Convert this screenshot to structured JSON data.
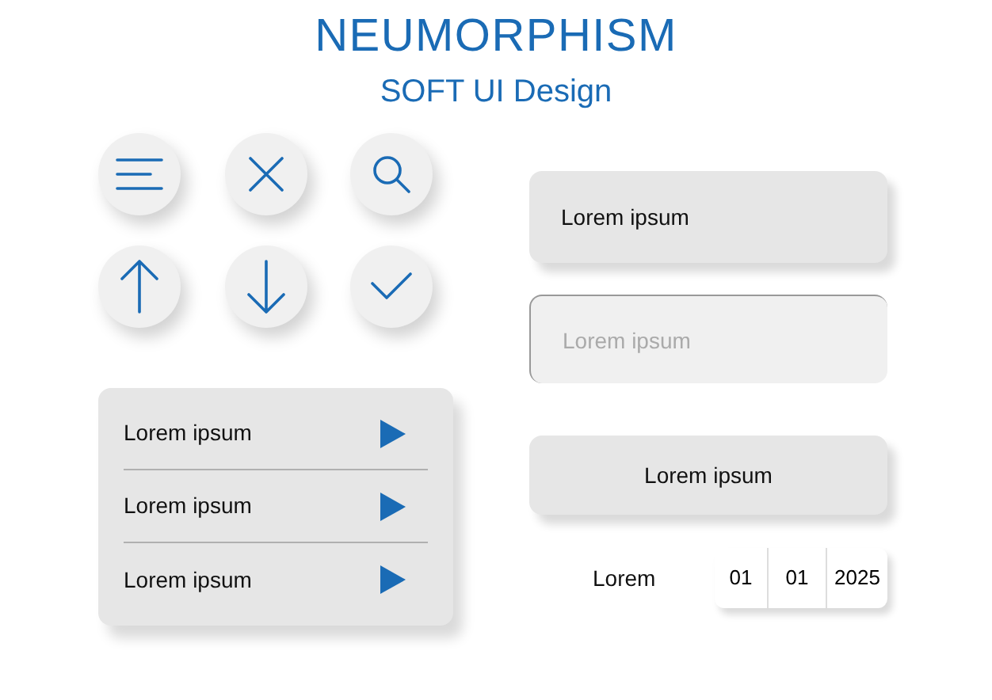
{
  "header": {
    "title": "NEUMORPHISM",
    "subtitle": "SOFT UI Design"
  },
  "icon_buttons": [
    {
      "kind": "menu"
    },
    {
      "kind": "close"
    },
    {
      "kind": "search"
    },
    {
      "kind": "up"
    },
    {
      "kind": "down"
    },
    {
      "kind": "check"
    }
  ],
  "list": [
    {
      "label": "Lorem ipsum"
    },
    {
      "label": "Lorem ipsum"
    },
    {
      "label": "Lorem ipsum"
    }
  ],
  "button_top": {
    "label": "Lorem ipsum"
  },
  "input": {
    "placeholder": "Lorem ipsum"
  },
  "button_bottom": {
    "label": "Lorem ipsum"
  },
  "date": {
    "label": "Lorem",
    "day": "01",
    "month": "01",
    "year": "2025"
  }
}
